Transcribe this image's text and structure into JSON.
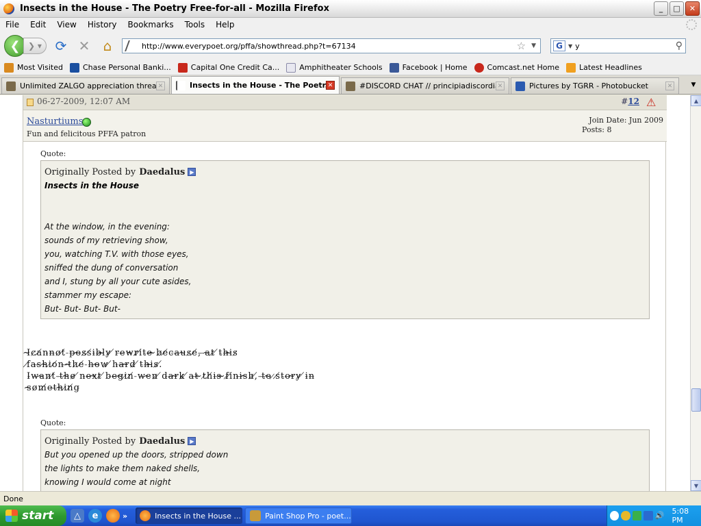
{
  "window": {
    "title": "Insects in the House - The Poetry Free-for-all - Mozilla Firefox",
    "controls": {
      "minimize": "_",
      "maximize": "□",
      "close": "✕"
    }
  },
  "menu": [
    "File",
    "Edit",
    "View",
    "History",
    "Bookmarks",
    "Tools",
    "Help"
  ],
  "nav": {
    "url": "http://www.everypoet.org/pffa/showthread.php?t=67134",
    "search_value": "y"
  },
  "bookmarks": [
    {
      "label": "Most Visited",
      "icon": "most-visited-icon",
      "color": "#d98a20"
    },
    {
      "label": "Chase Personal Banki...",
      "icon": "chase-icon",
      "color": "#1a4fa0"
    },
    {
      "label": "Capital One Credit Ca...",
      "icon": "capital-one-icon",
      "color": "#c8281c"
    },
    {
      "label": "Amphitheater Schools",
      "icon": "page-icon",
      "color": "#e8e8f0"
    },
    {
      "label": "Facebook | Home",
      "icon": "facebook-icon",
      "color": "#3b5998"
    },
    {
      "label": "Comcast.net Home",
      "icon": "comcast-icon",
      "color": "#c8281c"
    },
    {
      "label": "Latest Headlines",
      "icon": "rss-icon",
      "color": "#f0a020"
    }
  ],
  "tabs": [
    {
      "label": "Unlimited ZALGO appreciation thread!",
      "active": false,
      "icon_color": "#7a6a4a"
    },
    {
      "label": "Insects in the House - The Poetr...",
      "active": true,
      "icon_color": "#555555"
    },
    {
      "label": "#DISCORD CHAT // principiadiscordia.c...",
      "active": false,
      "icon_color": "#7a6a4a"
    },
    {
      "label": "Pictures by TGRR - Photobucket",
      "active": false,
      "icon_color": "#2a5ab0"
    }
  ],
  "post": {
    "date": "06-27-2009, 12:07 AM",
    "number_prefix": "#",
    "number": "12",
    "username": "Nasturtiums",
    "user_title": "Fun and felicitous PFFA patron",
    "join_date": "Join Date: Jun 2009",
    "posts": "Posts: 8",
    "quote1": {
      "label": "Quote:",
      "by_prefix": "Originally Posted by",
      "author": "Daedalus",
      "title": "Insects in the House",
      "lines": [
        "At the window, in the evening:",
        "sounds of my retrieving show,",
        "you, watching T.V. with those eyes,",
        "sniffed the dung of conversation",
        "and I, stung by all your cute asides,",
        "stammer my escape:",
        "But- But- But- But-"
      ]
    },
    "reply_lines": [
      "I̴c̷a̸n̵n̶o̷t̸ ̵p̶o̴s̷s̸i̵b̶l̴y̷ ̸r̵e̶w̴r̷i̸t̵e̶ ̴b̷e̸c̵a̶u̴s̷e̸,̵ ̶a̴t̷ ̸t̵h̶i̴s̷",
      "f̸a̵s̶h̴i̷o̸n̵ ̶t̴h̷e̸ ̵h̶o̴w̷ ̸h̵a̶r̴d̷ ̸t̵h̶i̴s̷.̸",
      "I̵w̶a̴n̷t̸ ̵t̶h̴e̷ ̸n̵e̶x̴t̷ ̸b̵e̶g̴i̷n̸ ̵w̶e̴n̷ ̸d̵a̶r̴k̷ ̸a̵t̶ ̴t̷h̸i̵s̶ ̴f̷i̸n̵i̶s̴h̷,̸ ̵t̶o̴ ̷s̸t̵o̶r̴y̷ ̸i̵n̶",
      "s̴o̷m̸e̵t̶h̴i̷n̸g̵"
    ],
    "quote2": {
      "label": "Quote:",
      "by_prefix": "Originally Posted by",
      "author": "Daedalus",
      "lines": [
        "But you opened up the doors, stripped down",
        "the lights to make them naked shells,",
        "knowing I would come at night"
      ]
    }
  },
  "status": "Done",
  "taskbar": {
    "start_label": "start",
    "more": "»",
    "tasks": [
      {
        "label": "Insects in the House ...",
        "active": true,
        "icon_color": "#e56a12"
      },
      {
        "label": "Paint Shop Pro - poet...",
        "active": false,
        "icon_color": "#c89a3a"
      }
    ],
    "clock": "5:08 PM"
  }
}
